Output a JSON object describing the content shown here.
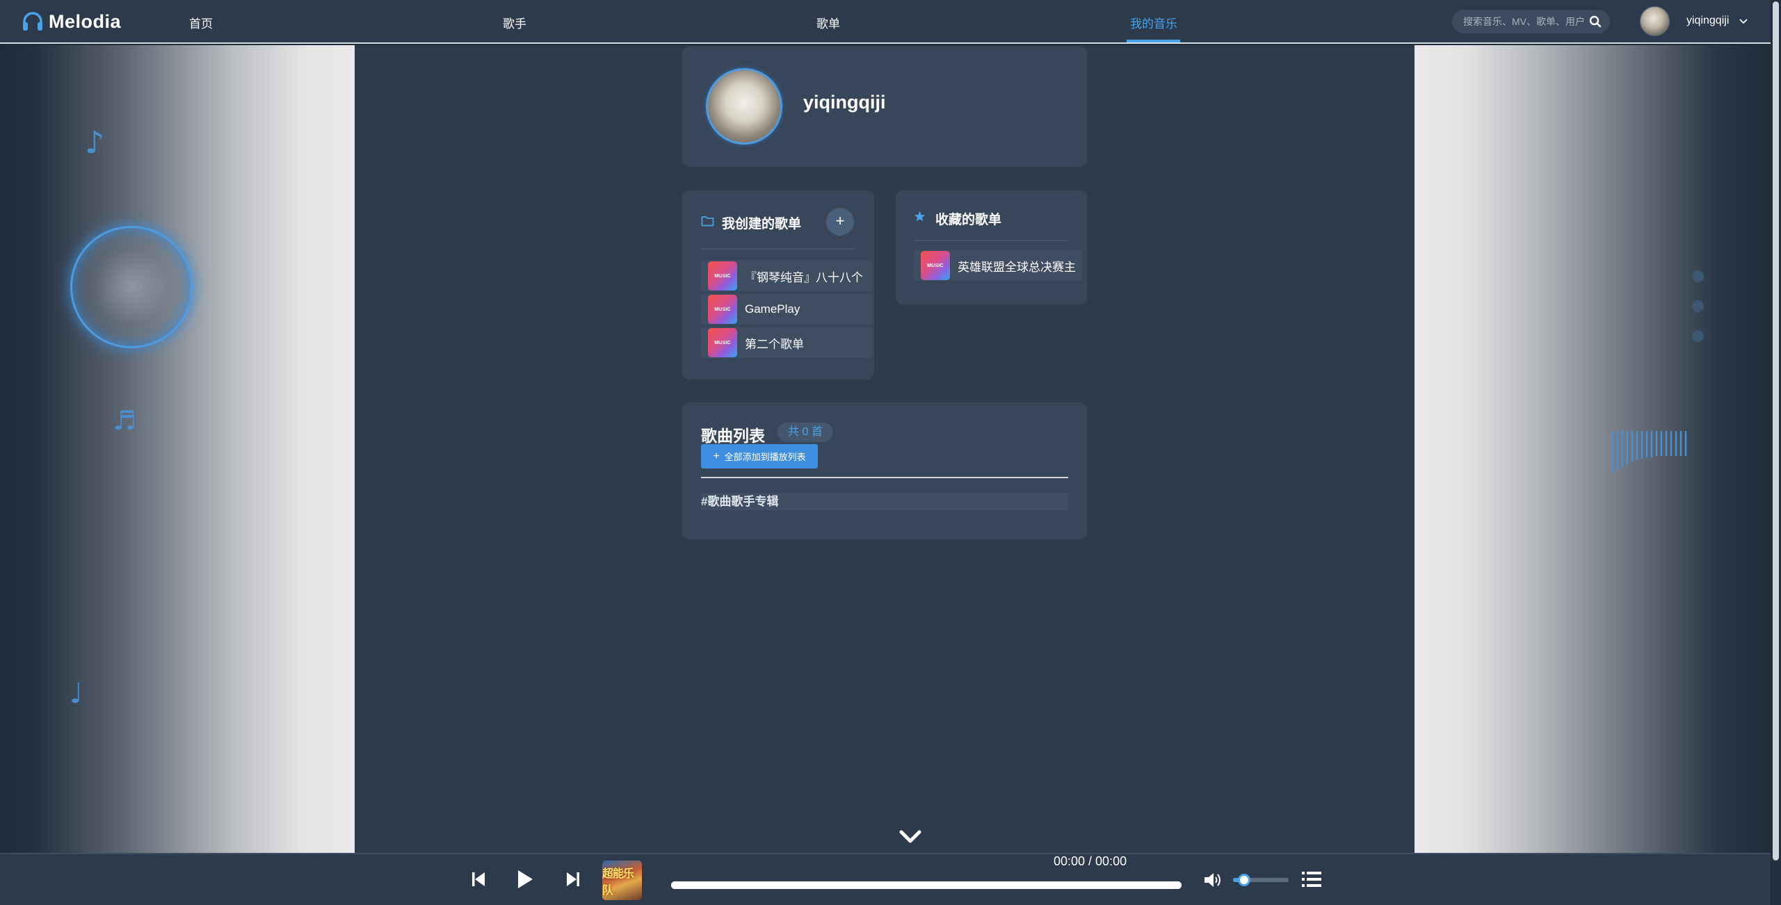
{
  "brand": {
    "name": "Melodia"
  },
  "nav": {
    "items": [
      {
        "label": "首页"
      },
      {
        "label": "歌手"
      },
      {
        "label": "歌单"
      },
      {
        "label": "我的音乐"
      }
    ],
    "active_index": 3
  },
  "search": {
    "placeholder": "搜索音乐、MV、歌单、用户",
    "value": ""
  },
  "user": {
    "name": "yiqingqiji"
  },
  "profile": {
    "name": "yiqingqiji"
  },
  "created_playlists": {
    "title": "我创建的歌单",
    "add_label": "+",
    "items": [
      {
        "name": "『钢琴纯音』八十八个",
        "cover_text": "MUSIC"
      },
      {
        "name": "GamePlay",
        "cover_text": "MUSIC"
      },
      {
        "name": "第二个歌单",
        "cover_text": "MUSIC"
      }
    ]
  },
  "collected_playlists": {
    "title": "收藏的歌单",
    "items": [
      {
        "name": "英雄联盟全球总决赛主",
        "cover_text": "MUSIC"
      }
    ]
  },
  "songs": {
    "title": "歌曲列表",
    "count_label": "共 0 首",
    "add_all_label": "全部添加到播放列表",
    "header": "#歌曲歌手专辑"
  },
  "player": {
    "time": "00:00 / 00:00",
    "album_text": "超能乐队",
    "progress": 0,
    "volume": 0.2
  },
  "colors": {
    "accent": "#4aa3e8",
    "nav_bg": "#2c3a4c",
    "main_bg": "#2e3b4d",
    "card_bg": "#38465a"
  },
  "icons": {
    "logo": "headphones-icon",
    "search": "search-icon",
    "folder": "folder-icon",
    "star": "star-icon",
    "prev": "skip-previous-icon",
    "play": "play-icon",
    "next": "skip-next-icon",
    "volume": "volume-icon",
    "playlist": "playlist-icon",
    "collapse": "chevron-down-icon"
  }
}
